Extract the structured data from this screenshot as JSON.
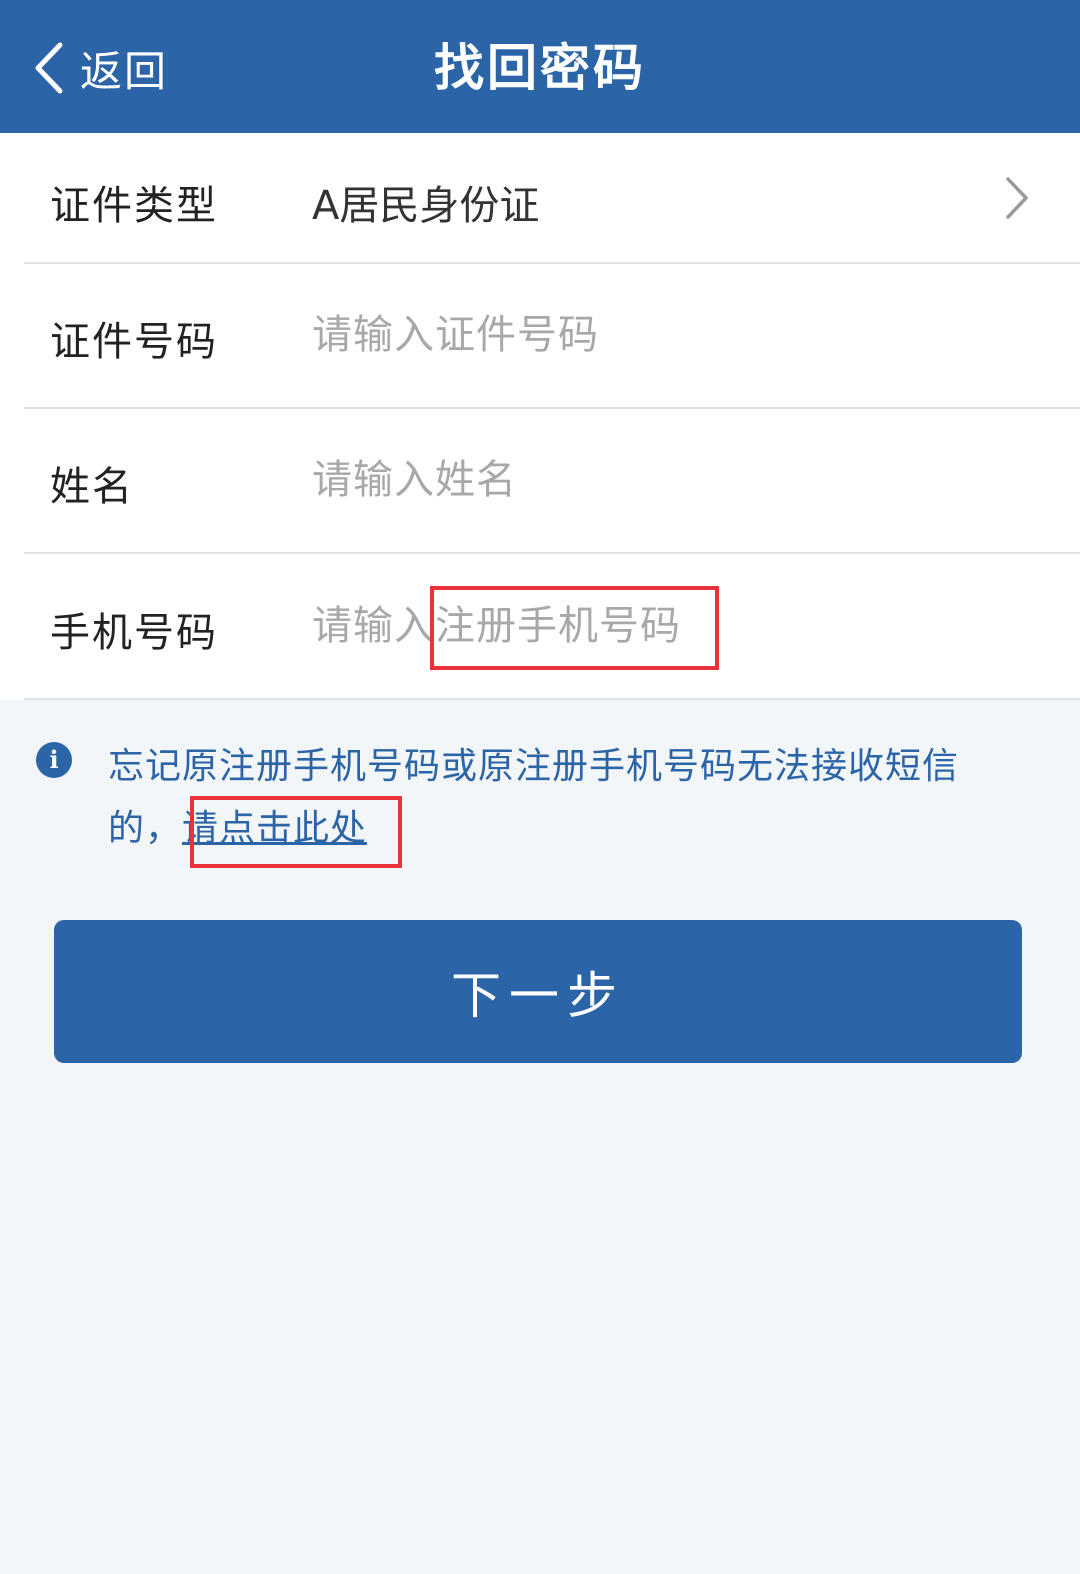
{
  "header": {
    "back_label": "返回",
    "title": "找回密码",
    "background_color": "#2c64a8"
  },
  "form": {
    "id_type": {
      "label": "证件类型",
      "value": "A居民身份证",
      "icon": "chevron-right-icon"
    },
    "id_number": {
      "label": "证件号码",
      "value": "",
      "placeholder": "请输入证件号码"
    },
    "name": {
      "label": "姓名",
      "value": "",
      "placeholder": "请输入姓名"
    },
    "phone": {
      "label": "手机号码",
      "value": "",
      "placeholder": "请输入注册手机号码"
    }
  },
  "notice": {
    "icon": "info-icon",
    "text": "忘记原注册手机号码或原注册手机号码无法接收短信的，",
    "link_text": "请点击此处"
  },
  "actions": {
    "next_label": "下一步"
  },
  "highlight_color": "#e8333a"
}
